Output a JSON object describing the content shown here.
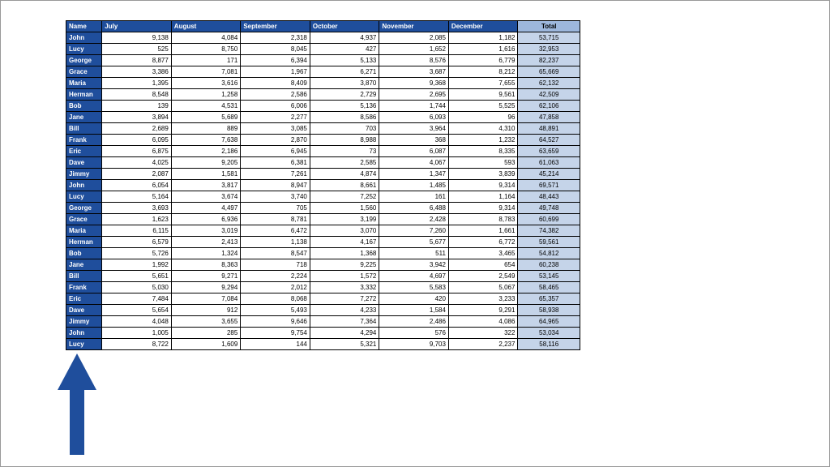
{
  "colors": {
    "header_bg": "#1f4e9c",
    "total_bg": "#c5d4e9",
    "total_head_bg": "#9db7dc",
    "arrow_fill": "#1f4e9c"
  },
  "headers": [
    "Name",
    "July",
    "August",
    "September",
    "October",
    "November",
    "December",
    "Total"
  ],
  "rows": [
    {
      "name": "John",
      "jul": "9,138",
      "aug": "4,084",
      "sep": "2,318",
      "oct": "4,937",
      "nov": "2,085",
      "dec": "1,182",
      "total": "53,715"
    },
    {
      "name": "Lucy",
      "jul": "525",
      "aug": "8,750",
      "sep": "8,045",
      "oct": "427",
      "nov": "1,652",
      "dec": "1,616",
      "total": "32,953"
    },
    {
      "name": "George",
      "jul": "8,877",
      "aug": "171",
      "sep": "6,394",
      "oct": "5,133",
      "nov": "8,576",
      "dec": "6,779",
      "total": "82,237"
    },
    {
      "name": "Grace",
      "jul": "3,386",
      "aug": "7,081",
      "sep": "1,967",
      "oct": "6,271",
      "nov": "3,687",
      "dec": "8,212",
      "total": "65,669"
    },
    {
      "name": "Maria",
      "jul": "1,395",
      "aug": "3,616",
      "sep": "8,409",
      "oct": "3,870",
      "nov": "9,368",
      "dec": "7,655",
      "total": "62,132"
    },
    {
      "name": "Herman",
      "jul": "8,548",
      "aug": "1,258",
      "sep": "2,586",
      "oct": "2,729",
      "nov": "2,695",
      "dec": "9,561",
      "total": "42,509"
    },
    {
      "name": "Bob",
      "jul": "139",
      "aug": "4,531",
      "sep": "6,006",
      "oct": "5,136",
      "nov": "1,744",
      "dec": "5,525",
      "total": "62,106"
    },
    {
      "name": "Jane",
      "jul": "3,894",
      "aug": "5,689",
      "sep": "2,277",
      "oct": "8,586",
      "nov": "6,093",
      "dec": "96",
      "total": "47,858"
    },
    {
      "name": "Bill",
      "jul": "2,689",
      "aug": "889",
      "sep": "3,085",
      "oct": "703",
      "nov": "3,964",
      "dec": "4,310",
      "total": "48,891"
    },
    {
      "name": "Frank",
      "jul": "6,095",
      "aug": "7,638",
      "sep": "2,870",
      "oct": "8,988",
      "nov": "368",
      "dec": "1,232",
      "total": "64,527"
    },
    {
      "name": "Eric",
      "jul": "6,875",
      "aug": "2,186",
      "sep": "6,945",
      "oct": "73",
      "nov": "6,087",
      "dec": "8,335",
      "total": "63,659"
    },
    {
      "name": "Dave",
      "jul": "4,025",
      "aug": "9,205",
      "sep": "6,381",
      "oct": "2,585",
      "nov": "4,067",
      "dec": "593",
      "total": "61,063"
    },
    {
      "name": "Jimmy",
      "jul": "2,087",
      "aug": "1,581",
      "sep": "7,261",
      "oct": "4,874",
      "nov": "1,347",
      "dec": "3,839",
      "total": "45,214"
    },
    {
      "name": "John",
      "jul": "6,054",
      "aug": "3,817",
      "sep": "8,947",
      "oct": "8,661",
      "nov": "1,485",
      "dec": "9,314",
      "total": "69,571"
    },
    {
      "name": "Lucy",
      "jul": "5,164",
      "aug": "3,674",
      "sep": "3,740",
      "oct": "7,252",
      "nov": "161",
      "dec": "1,164",
      "total": "48,443"
    },
    {
      "name": "George",
      "jul": "3,693",
      "aug": "4,497",
      "sep": "705",
      "oct": "1,560",
      "nov": "6,488",
      "dec": "9,314",
      "total": "49,748"
    },
    {
      "name": "Grace",
      "jul": "1,623",
      "aug": "6,936",
      "sep": "8,781",
      "oct": "3,199",
      "nov": "2,428",
      "dec": "8,783",
      "total": "60,699"
    },
    {
      "name": "Maria",
      "jul": "6,115",
      "aug": "3,019",
      "sep": "6,472",
      "oct": "3,070",
      "nov": "7,260",
      "dec": "1,661",
      "total": "74,382"
    },
    {
      "name": "Herman",
      "jul": "6,579",
      "aug": "2,413",
      "sep": "1,138",
      "oct": "4,167",
      "nov": "5,677",
      "dec": "6,772",
      "total": "59,561"
    },
    {
      "name": "Bob",
      "jul": "5,726",
      "aug": "1,324",
      "sep": "8,547",
      "oct": "1,368",
      "nov": "511",
      "dec": "3,465",
      "total": "54,812"
    },
    {
      "name": "Jane",
      "jul": "1,992",
      "aug": "8,363",
      "sep": "718",
      "oct": "9,225",
      "nov": "3,942",
      "dec": "654",
      "total": "60,238"
    },
    {
      "name": "Bill",
      "jul": "5,651",
      "aug": "9,271",
      "sep": "2,224",
      "oct": "1,572",
      "nov": "4,697",
      "dec": "2,549",
      "total": "53,145"
    },
    {
      "name": "Frank",
      "jul": "5,030",
      "aug": "9,294",
      "sep": "2,012",
      "oct": "3,332",
      "nov": "5,583",
      "dec": "5,067",
      "total": "58,465"
    },
    {
      "name": "Eric",
      "jul": "7,484",
      "aug": "7,084",
      "sep": "8,068",
      "oct": "7,272",
      "nov": "420",
      "dec": "3,233",
      "total": "65,357"
    },
    {
      "name": "Dave",
      "jul": "5,654",
      "aug": "912",
      "sep": "5,493",
      "oct": "4,233",
      "nov": "1,584",
      "dec": "9,291",
      "total": "58,938"
    },
    {
      "name": "Jimmy",
      "jul": "4,048",
      "aug": "3,655",
      "sep": "9,646",
      "oct": "7,364",
      "nov": "2,486",
      "dec": "4,086",
      "total": "64,965"
    },
    {
      "name": "John",
      "jul": "1,005",
      "aug": "285",
      "sep": "9,754",
      "oct": "4,294",
      "nov": "576",
      "dec": "322",
      "total": "53,034"
    },
    {
      "name": "Lucy",
      "jul": "8,722",
      "aug": "1,609",
      "sep": "144",
      "oct": "5,321",
      "nov": "9,703",
      "dec": "2,237",
      "total": "58,116"
    }
  ]
}
